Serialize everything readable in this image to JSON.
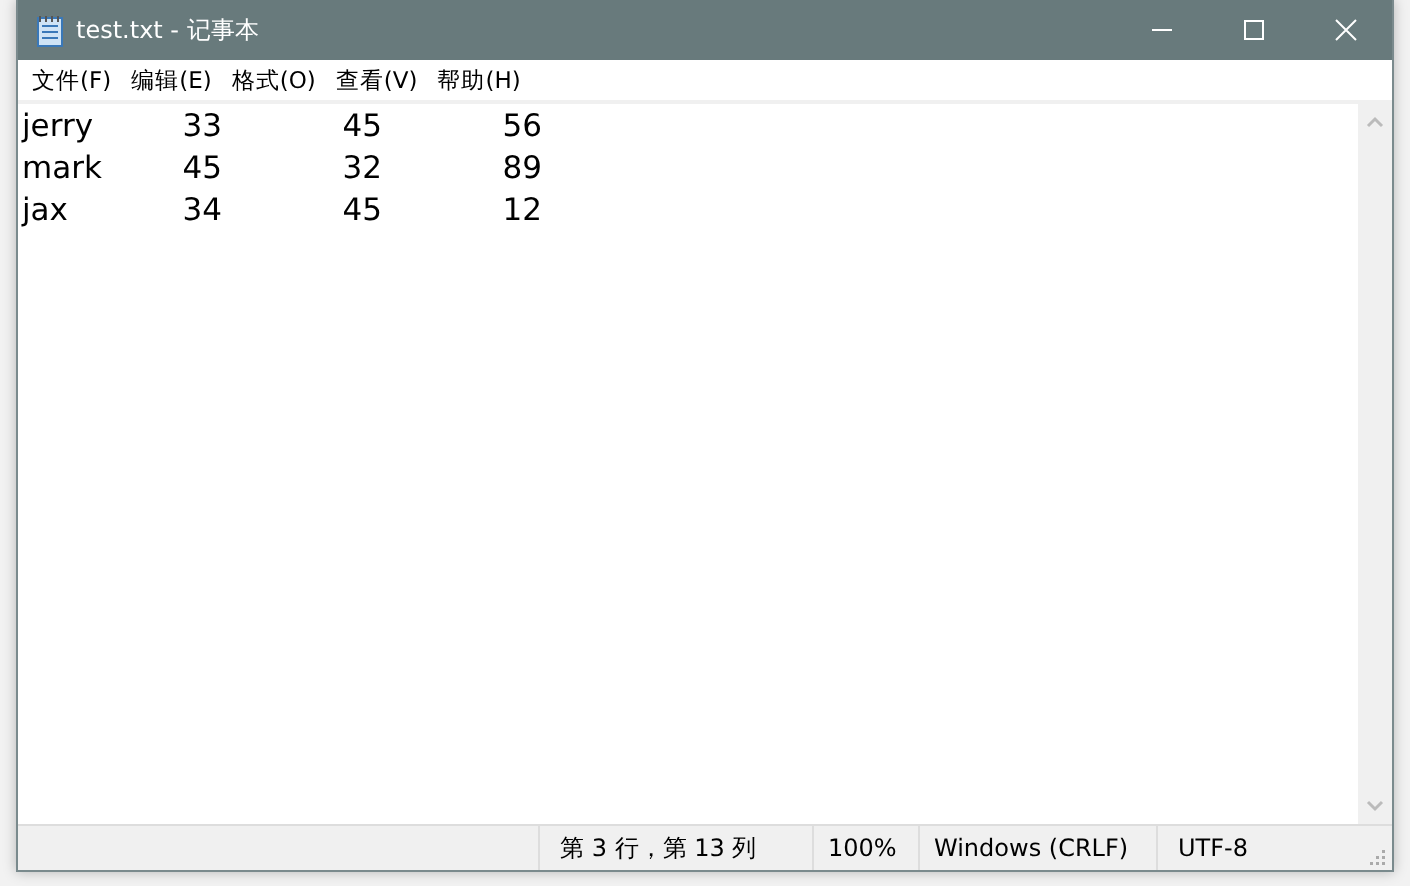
{
  "window": {
    "title": "test.txt - 记事本"
  },
  "menu": [
    {
      "label": "文件(F)"
    },
    {
      "label": "编辑(E)"
    },
    {
      "label": "格式(O)"
    },
    {
      "label": "查看(V)"
    },
    {
      "label": "帮助(H)"
    }
  ],
  "rows": [
    {
      "cells": [
        "jerry",
        "33",
        "45",
        "56"
      ]
    },
    {
      "cells": [
        "mark",
        "45",
        "32",
        "89"
      ]
    },
    {
      "cells": [
        "jax",
        "34",
        "45",
        "12"
      ]
    }
  ],
  "status_bar": [
    "第 3 行，第 13 列",
    "100%",
    "Windows (CRLF)",
    "UTF-8"
  ]
}
